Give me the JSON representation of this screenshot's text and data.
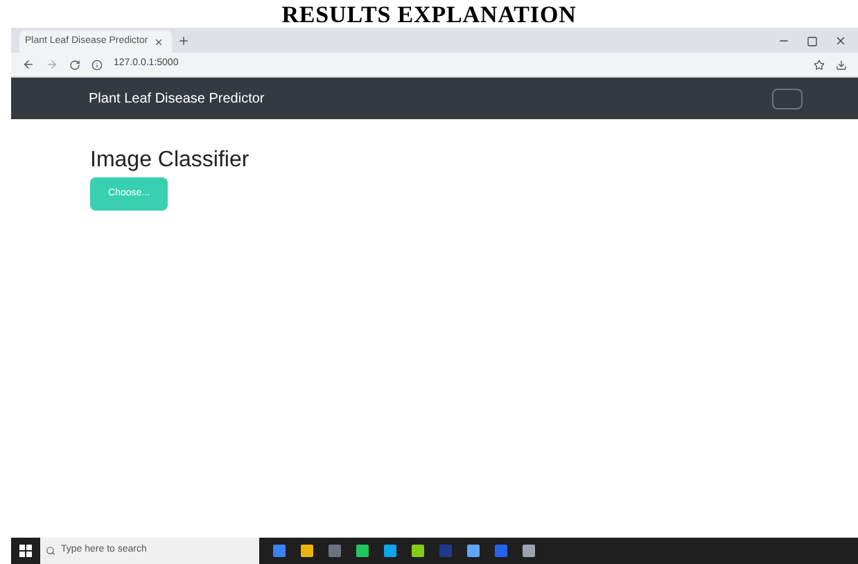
{
  "slide_title": "RESULTS EXPLANATION",
  "browser": {
    "tab_title": "Plant Leaf Disease Predictor",
    "address": "127.0.0.1:5000"
  },
  "navbar": {
    "brand": "Plant Leaf Disease Predictor"
  },
  "page": {
    "heading": "Image Classifier",
    "button": "Choose..."
  },
  "taskbar": {
    "search_placeholder": "Type here to search"
  }
}
